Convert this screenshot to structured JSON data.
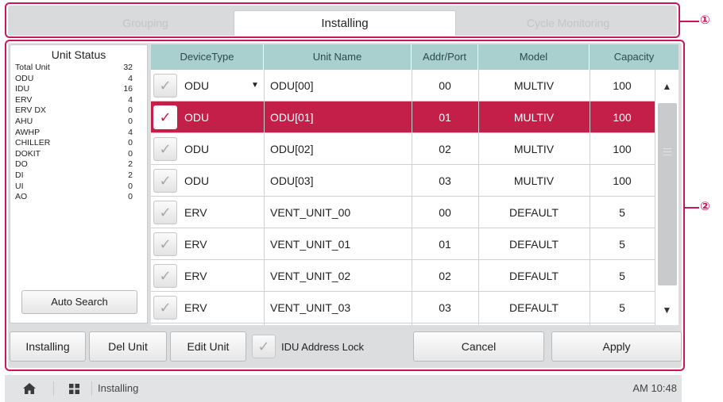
{
  "callouts": {
    "one": "①",
    "two": "②"
  },
  "tabs": [
    {
      "label": "Grouping",
      "active": false
    },
    {
      "label": "Installing",
      "active": true
    },
    {
      "label": "Cycle Monitoring",
      "active": false
    }
  ],
  "unit_status": {
    "title": "Unit Status",
    "rows": [
      {
        "label": "Total Unit",
        "count": "32"
      },
      {
        "label": "ODU",
        "count": "4"
      },
      {
        "label": "IDU",
        "count": "16"
      },
      {
        "label": "ERV",
        "count": "4"
      },
      {
        "label": "ERV DX",
        "count": "0"
      },
      {
        "label": "AHU",
        "count": "0"
      },
      {
        "label": "AWHP",
        "count": "4"
      },
      {
        "label": "CHILLER",
        "count": "0"
      },
      {
        "label": "DOKIT",
        "count": "0"
      },
      {
        "label": "DO",
        "count": "2"
      },
      {
        "label": "DI",
        "count": "2"
      },
      {
        "label": "UI",
        "count": "0"
      },
      {
        "label": "AO",
        "count": "0"
      }
    ],
    "auto_search_label": "Auto Search"
  },
  "table": {
    "headers": [
      "DeviceType",
      "Unit Name",
      "Addr/Port",
      "Model",
      "Capacity"
    ],
    "rows": [
      {
        "checked": false,
        "selected": false,
        "device": "ODU",
        "dropdown": true,
        "name": "ODU[00]",
        "addr": "00",
        "model": "MULTIV",
        "capacity": "100"
      },
      {
        "checked": true,
        "selected": true,
        "device": "ODU",
        "dropdown": false,
        "name": "ODU[01]",
        "addr": "01",
        "model": "MULTIV",
        "capacity": "100"
      },
      {
        "checked": false,
        "selected": false,
        "device": "ODU",
        "dropdown": false,
        "name": "ODU[02]",
        "addr": "02",
        "model": "MULTIV",
        "capacity": "100"
      },
      {
        "checked": false,
        "selected": false,
        "device": "ODU",
        "dropdown": false,
        "name": "ODU[03]",
        "addr": "03",
        "model": "MULTIV",
        "capacity": "100"
      },
      {
        "checked": false,
        "selected": false,
        "device": "ERV",
        "dropdown": false,
        "name": "VENT_UNIT_00",
        "addr": "00",
        "model": "DEFAULT",
        "capacity": "5"
      },
      {
        "checked": false,
        "selected": false,
        "device": "ERV",
        "dropdown": false,
        "name": "VENT_UNIT_01",
        "addr": "01",
        "model": "DEFAULT",
        "capacity": "5"
      },
      {
        "checked": false,
        "selected": false,
        "device": "ERV",
        "dropdown": false,
        "name": "VENT_UNIT_02",
        "addr": "02",
        "model": "DEFAULT",
        "capacity": "5"
      },
      {
        "checked": false,
        "selected": false,
        "device": "ERV",
        "dropdown": false,
        "name": "VENT_UNIT_03",
        "addr": "03",
        "model": "DEFAULT",
        "capacity": "5"
      }
    ]
  },
  "buttons": {
    "installing": "Installing",
    "del_unit": "Del Unit",
    "edit_unit": "Edit Unit",
    "idu_lock": "IDU Address Lock",
    "cancel": "Cancel",
    "apply": "Apply"
  },
  "statusbar": {
    "title": "Installing",
    "time": "AM 10:48"
  },
  "icons": {
    "check": "checkmark-icon",
    "home": "home-icon",
    "grid": "grid-icon"
  },
  "colors": {
    "accent": "#c41f48",
    "header": "#a9cfcf",
    "callout": "#c8185a"
  }
}
